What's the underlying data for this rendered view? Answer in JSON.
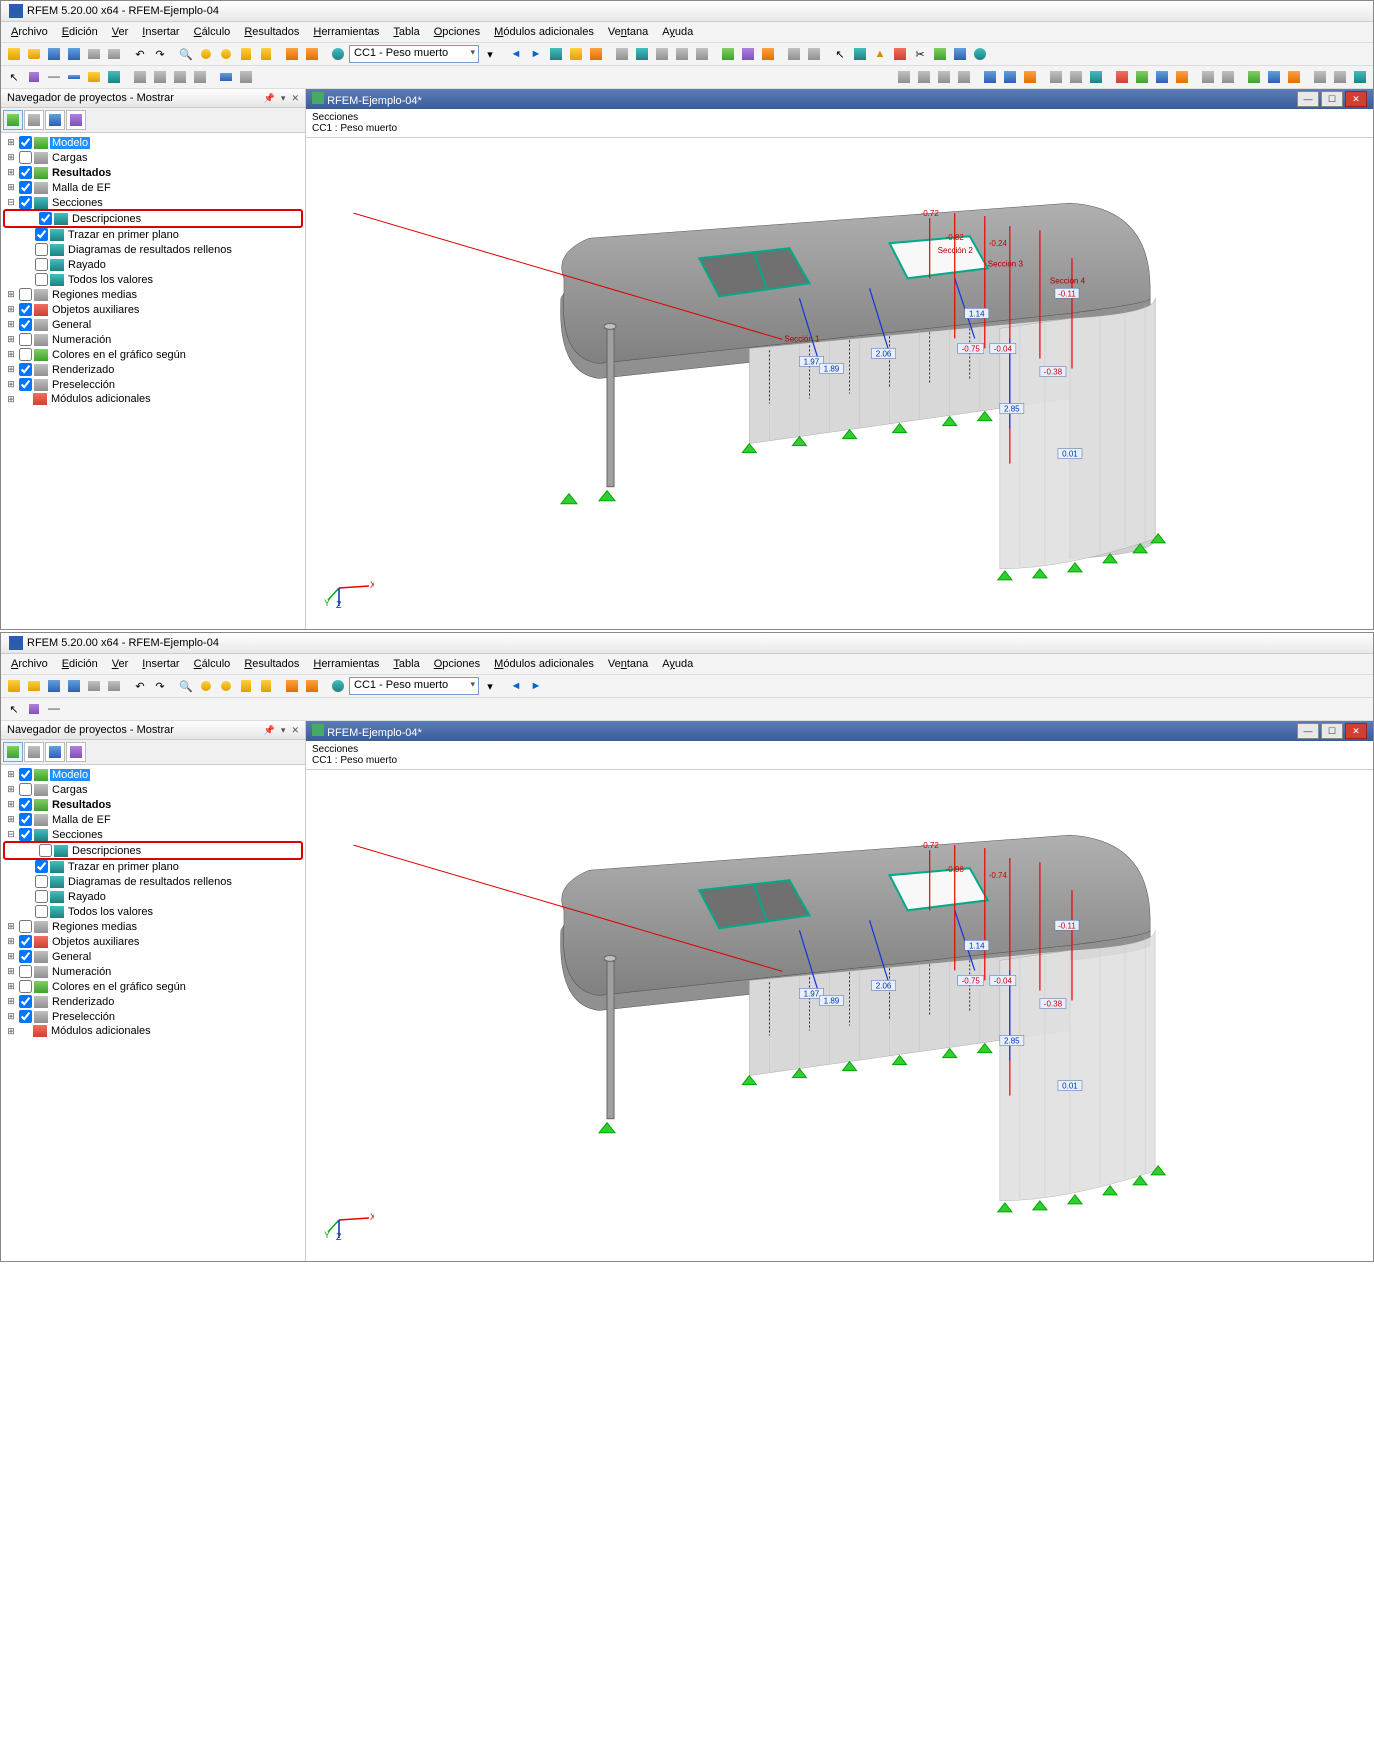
{
  "app": {
    "title": "RFEM 5.20.00 x64 - RFEM-Ejemplo-04",
    "doc_title": "RFEM-Ejemplo-04*"
  },
  "menu": {
    "archivo": "Archivo",
    "edicion": "Edición",
    "ver": "Ver",
    "insertar": "Insertar",
    "calculo": "Cálculo",
    "resultados": "Resultados",
    "herramientas": "Herramientas",
    "tabla": "Tabla",
    "opciones": "Opciones",
    "modulos": "Módulos adicionales",
    "ventana": "Ventana",
    "ayuda": "Ayuda"
  },
  "toolbar": {
    "combo_lc": "CC1 - Peso muerto"
  },
  "nav": {
    "header": "Navegador de proyectos - Mostrar",
    "items": {
      "modelo": "Modelo",
      "cargas": "Cargas",
      "resultados": "Resultados",
      "malla": "Malla de EF",
      "secciones": "Secciones",
      "descripciones": "Descripciones",
      "primer_plano": "Trazar en primer plano",
      "diagramas": "Diagramas de resultados rellenos",
      "rayado": "Rayado",
      "todos_valores": "Todos los valores",
      "regiones": "Regiones medias",
      "objetos_aux": "Objetos auxiliares",
      "general": "General",
      "numeracion": "Numeración",
      "colores": "Colores en el gráfico según",
      "renderizado": "Renderizado",
      "preseleccion": "Preselección",
      "modulos_add": "Módulos adicionales"
    }
  },
  "viewport": {
    "line1": "Secciones",
    "line2": "CC1 : Peso muerto",
    "sec_labels": {
      "s1": "Sección 1",
      "s2": "Sección 2",
      "s3": "Sección 3",
      "s4": "Sección 4"
    },
    "values": {
      "top1": "-0.72",
      "top2": "-0.98",
      "top3": "-0.74",
      "top4": "-0.11",
      "mid_blue1": "1.97",
      "mid_blue2": "2.06",
      "mid_blue3": "1.14",
      "red_low1": "-0.75",
      "red_low2": "-0.04",
      "red_right": "-0.38",
      "left_189": "1.89",
      "blue_285": "2.85",
      "right_001": "0.01"
    },
    "values_top_variant": {
      "top2": "-0.98",
      "top2_alt": "-0.82",
      "top3": "-0.74",
      "top3_alt": "-0.24"
    }
  }
}
